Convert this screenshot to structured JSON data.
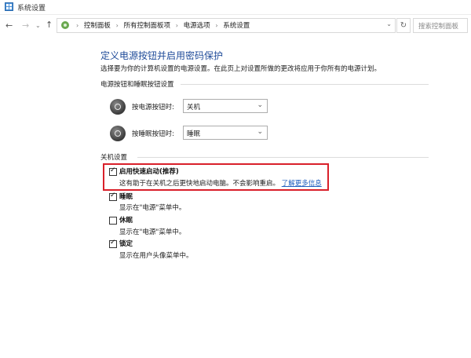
{
  "window": {
    "title": "系统设置"
  },
  "nav": {
    "back_icon": "back-arrow-icon",
    "forward_icon": "forward-arrow-icon",
    "up_icon": "up-arrow-icon",
    "breadcrumbs": [
      "控制面板",
      "所有控制面板项",
      "电源选项",
      "系统设置"
    ],
    "search_placeholder": "搜索控制面板"
  },
  "main": {
    "title": "定义电源按钮并启用密码保护",
    "description": "选择要为你的计算机设置的电源设置。在此页上对设置所做的更改将应用于你所有的电源计划。",
    "buttons_group": {
      "label": "电源按钮和睡眠按钮设置",
      "power_button": {
        "label": "按电源按钮时:",
        "value": "关机"
      },
      "sleep_button": {
        "label": "按睡眠按钮时:",
        "value": "睡眠"
      }
    },
    "shutdown_group": {
      "label": "关机设置",
      "fast_startup": {
        "label": "启用快速启动(推荐)",
        "checked": true,
        "description": "这有助于在关机之后更快地启动电脑。不会影响重启。",
        "link": "了解更多信息"
      },
      "sleep": {
        "label": "睡眠",
        "checked": true,
        "description": "显示在\"电源\"菜单中。"
      },
      "hibernate": {
        "label": "休眠",
        "checked": false,
        "description": "显示在\"电源\"菜单中。"
      },
      "lock": {
        "label": "锁定",
        "checked": true,
        "description": "显示在用户头像菜单中。"
      }
    }
  },
  "colors": {
    "heading": "#1f4b99",
    "highlight": "#d9202a",
    "link": "#1f5fbf"
  }
}
